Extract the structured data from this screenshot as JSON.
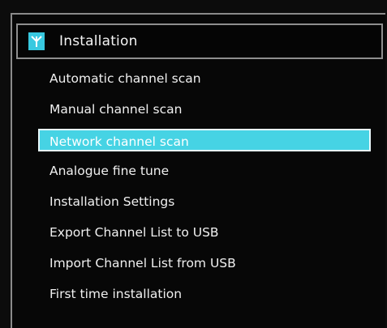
{
  "header": {
    "icon": "antenna-icon",
    "title": "Installation"
  },
  "colors": {
    "accent": "#46d3e4",
    "background": "#0b0b0b",
    "text": "#f0f0f0"
  },
  "menu": {
    "selected_index": 2,
    "items": [
      {
        "label": "Automatic channel scan"
      },
      {
        "label": "Manual channel scan"
      },
      {
        "label": "Network channel scan"
      },
      {
        "label": "Analogue fine tune"
      },
      {
        "label": "Installation Settings"
      },
      {
        "label": "Export Channel List to USB"
      },
      {
        "label": "Import Channel List from USB"
      },
      {
        "label": "First time installation"
      }
    ]
  }
}
